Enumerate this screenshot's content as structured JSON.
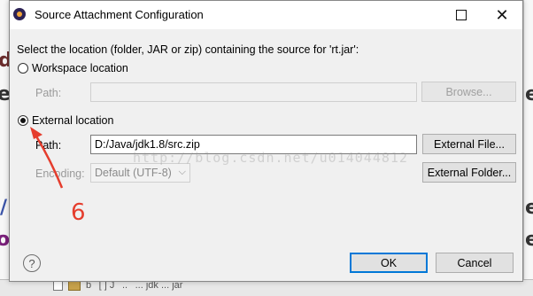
{
  "background": {
    "left_glyphs": [
      "d",
      "e",
      "/",
      "o"
    ],
    "right_glyphs": [
      "e",
      "e",
      "e"
    ],
    "bottom_text": "b  [ ] J  ..  ... jdk ... jar"
  },
  "dialog": {
    "title": "Source Attachment Configuration",
    "instruction": "Select the location (folder, JAR or zip) containing the source for 'rt.jar':",
    "workspace": {
      "radio_label": "Workspace location",
      "selected": false,
      "path_label": "Path:",
      "path_value": "",
      "browse_label": "Browse..."
    },
    "external": {
      "radio_label": "External location",
      "selected": true,
      "path_label": "Path:",
      "path_value": "D:/Java/jdk1.8/src.zip",
      "external_file_label": "External File...",
      "encoding_label": "Encoding:",
      "encoding_value": "Default (UTF-8)",
      "external_folder_label": "External Folder..."
    },
    "help_symbol": "?",
    "ok_label": "OK",
    "cancel_label": "Cancel"
  },
  "watermark": "http://blog.csdn.net/u014044812",
  "annotation": {
    "number": "6",
    "color": "#e53d2d"
  },
  "colors": {
    "accent": "#0078d7"
  }
}
